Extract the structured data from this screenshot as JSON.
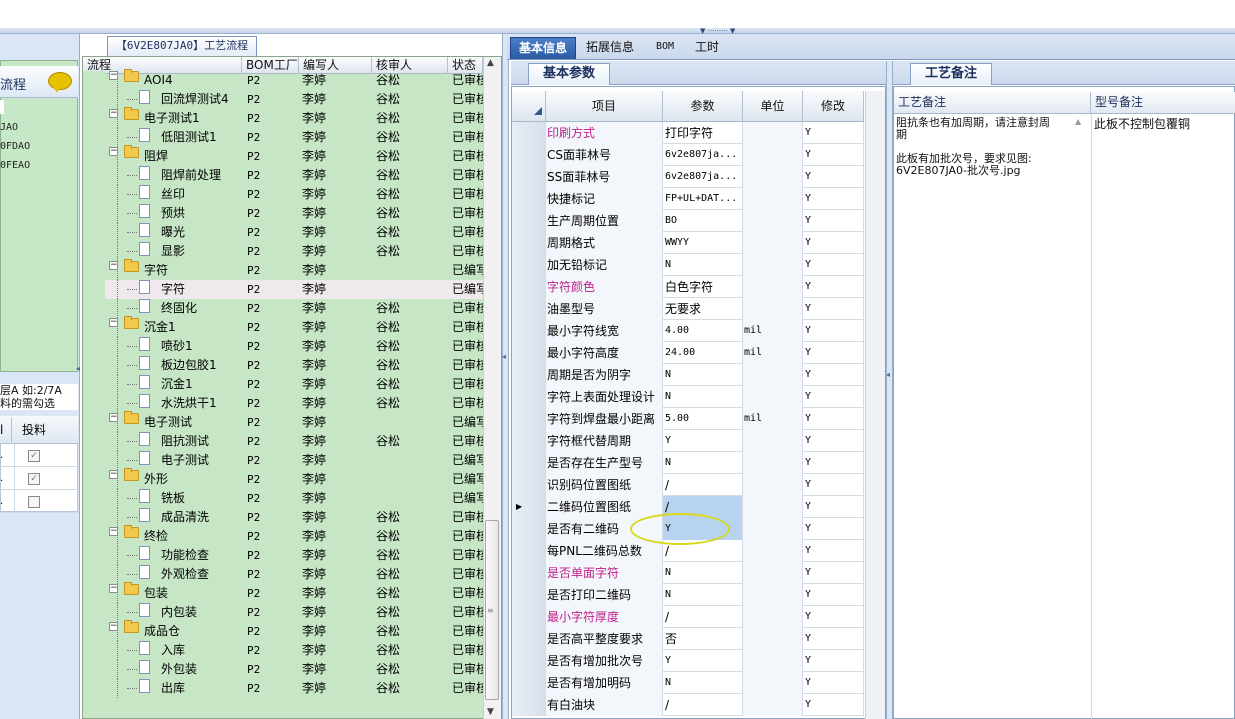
{
  "left": {
    "title": "流程",
    "items": [
      "JAO",
      "0FDAO",
      "0FEAO"
    ],
    "note_lines": [
      "层A 如:2/7A",
      "料的需勾选"
    ],
    "grid_header": "投料",
    "checks": [
      true,
      true,
      false
    ]
  },
  "tree": {
    "tab_label": "【6V2E807JA0】工艺流程",
    "columns": [
      "流程",
      "BOM工厂",
      "编写人",
      "核审人",
      "状态"
    ],
    "rows": [
      {
        "level": 0,
        "label": "AOI4",
        "factory": "P2",
        "writer": "李婷",
        "reviewer": "谷松",
        "status": "已审核"
      },
      {
        "level": 1,
        "label": "回流焊测试4",
        "factory": "P2",
        "writer": "李婷",
        "reviewer": "谷松",
        "status": "已审核"
      },
      {
        "level": 0,
        "label": "电子测试1",
        "factory": "P2",
        "writer": "李婷",
        "reviewer": "谷松",
        "status": "已审核"
      },
      {
        "level": 1,
        "label": "低阻测试1",
        "factory": "P2",
        "writer": "李婷",
        "reviewer": "谷松",
        "status": "已审核"
      },
      {
        "level": 0,
        "label": "阻焊",
        "factory": "P2",
        "writer": "李婷",
        "reviewer": "谷松",
        "status": "已审核"
      },
      {
        "level": 1,
        "label": "阻焊前处理",
        "factory": "P2",
        "writer": "李婷",
        "reviewer": "谷松",
        "status": "已审核"
      },
      {
        "level": 1,
        "label": "丝印",
        "factory": "P2",
        "writer": "李婷",
        "reviewer": "谷松",
        "status": "已审核"
      },
      {
        "level": 1,
        "label": "预烘",
        "factory": "P2",
        "writer": "李婷",
        "reviewer": "谷松",
        "status": "已审核"
      },
      {
        "level": 1,
        "label": "曝光",
        "factory": "P2",
        "writer": "李婷",
        "reviewer": "谷松",
        "status": "已审核"
      },
      {
        "level": 1,
        "label": "显影",
        "factory": "P2",
        "writer": "李婷",
        "reviewer": "谷松",
        "status": "已审核"
      },
      {
        "level": 0,
        "label": "字符",
        "factory": "P2",
        "writer": "李婷",
        "reviewer": "",
        "status": "已编写"
      },
      {
        "level": 1,
        "label": "字符",
        "factory": "P2",
        "writer": "李婷",
        "reviewer": "",
        "status": "已编写"
      },
      {
        "level": 1,
        "label": "终固化",
        "factory": "P2",
        "writer": "李婷",
        "reviewer": "谷松",
        "status": "已审核"
      },
      {
        "level": 0,
        "label": "沉金1",
        "factory": "P2",
        "writer": "李婷",
        "reviewer": "谷松",
        "status": "已审核"
      },
      {
        "level": 1,
        "label": "喷砂1",
        "factory": "P2",
        "writer": "李婷",
        "reviewer": "谷松",
        "status": "已审核"
      },
      {
        "level": 1,
        "label": "板边包胶1",
        "factory": "P2",
        "writer": "李婷",
        "reviewer": "谷松",
        "status": "已审核"
      },
      {
        "level": 1,
        "label": "沉金1",
        "factory": "P2",
        "writer": "李婷",
        "reviewer": "谷松",
        "status": "已审核"
      },
      {
        "level": 1,
        "label": "水洗烘干1",
        "factory": "P2",
        "writer": "李婷",
        "reviewer": "谷松",
        "status": "已审核"
      },
      {
        "level": 0,
        "label": "电子测试",
        "factory": "P2",
        "writer": "李婷",
        "reviewer": "",
        "status": "已编写"
      },
      {
        "level": 1,
        "label": "阻抗测试",
        "factory": "P2",
        "writer": "李婷",
        "reviewer": "谷松",
        "status": "已审核"
      },
      {
        "level": 1,
        "label": "电子测试",
        "factory": "P2",
        "writer": "李婷",
        "reviewer": "",
        "status": "已编写"
      },
      {
        "level": 0,
        "label": "外形",
        "factory": "P2",
        "writer": "李婷",
        "reviewer": "",
        "status": "已编写"
      },
      {
        "level": 1,
        "label": "铣板",
        "factory": "P2",
        "writer": "李婷",
        "reviewer": "",
        "status": "已编写"
      },
      {
        "level": 1,
        "label": "成品清洗",
        "factory": "P2",
        "writer": "李婷",
        "reviewer": "谷松",
        "status": "已审核"
      },
      {
        "level": 0,
        "label": "终检",
        "factory": "P2",
        "writer": "李婷",
        "reviewer": "谷松",
        "status": "已审核"
      },
      {
        "level": 1,
        "label": "功能检查",
        "factory": "P2",
        "writer": "李婷",
        "reviewer": "谷松",
        "status": "已审核"
      },
      {
        "level": 1,
        "label": "外观检查",
        "factory": "P2",
        "writer": "李婷",
        "reviewer": "谷松",
        "status": "已审核"
      },
      {
        "level": 0,
        "label": "包装",
        "factory": "P2",
        "writer": "李婷",
        "reviewer": "谷松",
        "status": "已审核"
      },
      {
        "level": 1,
        "label": "内包装",
        "factory": "P2",
        "writer": "李婷",
        "reviewer": "谷松",
        "status": "已审核"
      },
      {
        "level": 0,
        "label": "成品仓",
        "factory": "P2",
        "writer": "李婷",
        "reviewer": "谷松",
        "status": "已审核"
      },
      {
        "level": 1,
        "label": "入库",
        "factory": "P2",
        "writer": "李婷",
        "reviewer": "谷松",
        "status": "已审核"
      },
      {
        "level": 1,
        "label": "外包装",
        "factory": "P2",
        "writer": "李婷",
        "reviewer": "谷松",
        "status": "已审核"
      },
      {
        "level": 1,
        "label": "出库",
        "factory": "P2",
        "writer": "李婷",
        "reviewer": "谷松",
        "status": "已审核"
      }
    ],
    "selected_row": 11
  },
  "tabs": [
    "基本信息",
    "拓展信息",
    "BOM",
    "工时"
  ],
  "active_tab": 0,
  "basic": {
    "subtab": "基本参数",
    "columns": [
      "项目",
      "参数",
      "单位",
      "修改"
    ],
    "rows": [
      {
        "item": "印刷方式",
        "value": "打印字符",
        "unit": "",
        "mod": "Y",
        "pink": true
      },
      {
        "item": "CS面菲林号",
        "value": "6v2e807ja...",
        "unit": "",
        "mod": "Y",
        "pink": false
      },
      {
        "item": "SS面菲林号",
        "value": "6v2e807ja...",
        "unit": "",
        "mod": "Y",
        "pink": false
      },
      {
        "item": "快捷标记",
        "value": "FP+UL+DAT...",
        "unit": "",
        "mod": "Y",
        "pink": false
      },
      {
        "item": "生产周期位置",
        "value": "BO",
        "unit": "",
        "mod": "Y",
        "pink": false
      },
      {
        "item": "周期格式",
        "value": "WWYY",
        "unit": "",
        "mod": "Y",
        "pink": false
      },
      {
        "item": "加无铅标记",
        "value": "N",
        "unit": "",
        "mod": "Y",
        "pink": false
      },
      {
        "item": "字符颜色",
        "value": "白色字符",
        "unit": "",
        "mod": "Y",
        "pink": true
      },
      {
        "item": "油墨型号",
        "value": "无要求",
        "unit": "",
        "mod": "Y",
        "pink": false
      },
      {
        "item": "最小字符线宽",
        "value": "4.00",
        "unit": "mil",
        "mod": "Y",
        "pink": false
      },
      {
        "item": "最小字符高度",
        "value": "24.00",
        "unit": "mil",
        "mod": "Y",
        "pink": false
      },
      {
        "item": "周期是否为阴字",
        "value": "N",
        "unit": "",
        "mod": "Y",
        "pink": false
      },
      {
        "item": "字符上表面处理设计",
        "value": "N",
        "unit": "",
        "mod": "Y",
        "pink": false
      },
      {
        "item": "字符到焊盘最小距离",
        "value": "5.00",
        "unit": "mil",
        "mod": "Y",
        "pink": false
      },
      {
        "item": "字符框代替周期",
        "value": "Y",
        "unit": "",
        "mod": "Y",
        "pink": false
      },
      {
        "item": "是否存在生产型号",
        "value": "N",
        "unit": "",
        "mod": "Y",
        "pink": false
      },
      {
        "item": "识别码位置图纸",
        "value": "/",
        "unit": "",
        "mod": "Y",
        "pink": false
      },
      {
        "item": "二维码位置图纸",
        "value": "/",
        "unit": "",
        "mod": "Y",
        "pink": false
      },
      {
        "item": "是否有二维码",
        "value": "Y",
        "unit": "",
        "mod": "Y",
        "pink": false
      },
      {
        "item": "每PNL二维码总数",
        "value": "/",
        "unit": "",
        "mod": "Y",
        "pink": false
      },
      {
        "item": "是否单面字符",
        "value": "N",
        "unit": "",
        "mod": "Y",
        "pink": true
      },
      {
        "item": "是否打印二维码",
        "value": "N",
        "unit": "",
        "mod": "Y",
        "pink": false
      },
      {
        "item": "最小字符厚度",
        "value": "/",
        "unit": "",
        "mod": "Y",
        "pink": true
      },
      {
        "item": "是否高平整度要求",
        "value": "否",
        "unit": "",
        "mod": "Y",
        "pink": false
      },
      {
        "item": "是否有增加批次号",
        "value": "Y",
        "unit": "",
        "mod": "Y",
        "pink": false
      },
      {
        "item": "是否有增加明码",
        "value": "N",
        "unit": "",
        "mod": "Y",
        "pink": false
      },
      {
        "item": "有白油块",
        "value": "/",
        "unit": "",
        "mod": "Y",
        "pink": false
      }
    ],
    "current_row": 17,
    "highlight_rows": [
      17,
      18
    ]
  },
  "remarks": {
    "subtab": "工艺备注",
    "col1": "工艺备注",
    "col2": "型号备注",
    "process_note": "阻抗条也有加周期，请注意封周\n期\n\n此板有加批次号，要求见图:\n6V2E807JA0-批次号.jpg",
    "model_note": "此板不控制包覆铜"
  },
  "colors": {
    "pink": "#c0208c",
    "tab_active": "#2b5aa3",
    "tree_bg": "#c6e6c6",
    "highlight": "#b8d3f0"
  }
}
